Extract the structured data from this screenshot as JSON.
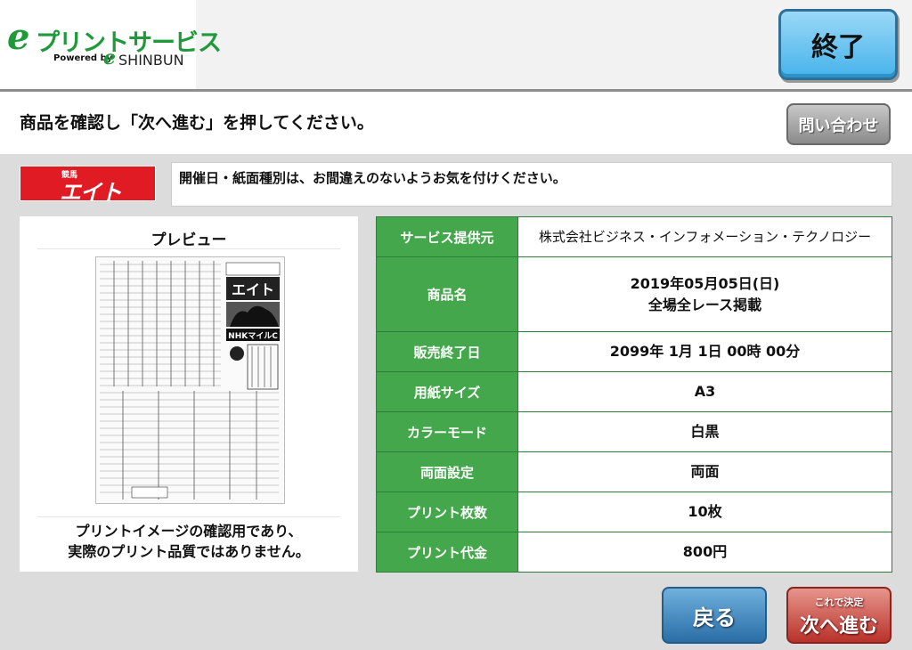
{
  "header": {
    "logo_e": "e",
    "logo_main": "プリントサービス",
    "logo_powered_by": "Powered by",
    "logo_e2": "e",
    "logo_shinbun": "SHINBUN",
    "end_button": "終了"
  },
  "instruction": {
    "text": "商品を確認し「次へ進む」を押してください。",
    "contact_button": "問い合わせ"
  },
  "paper_logo": {
    "small": "競馬",
    "big": "エイト",
    "color": "#e11b23"
  },
  "notice": "開催日・紙面種別は、お間違えのないようお気を付けください。",
  "preview": {
    "title": "プレビュー",
    "thumbnail_headline": "NHKマイルC",
    "thumbnail_masthead": "エイト",
    "caption_line1": "プリントイメージの確認用であり、",
    "caption_line2": "実際のプリント品質ではありません。"
  },
  "details": [
    {
      "label": "サービス提供元",
      "value": "株式会社ビジネス・インフォメーション・テクノロジー"
    },
    {
      "label": "商品名",
      "value": "2019年05月05日(日)",
      "value2": "全場全レース掲載"
    },
    {
      "label": "販売終了日",
      "value": "2099年 1月 1日 00時 00分"
    },
    {
      "label": "用紙サイズ",
      "value": "A3"
    },
    {
      "label": "カラーモード",
      "value": "白黒"
    },
    {
      "label": "両面設定",
      "value": "両面"
    },
    {
      "label": "プリント枚数",
      "value": "10枚"
    },
    {
      "label": "プリント代金",
      "value": "800円"
    }
  ],
  "buttons": {
    "back": "戻る",
    "next_small": "これで決定",
    "next_big": "次へ進む"
  },
  "colors": {
    "brand_green": "#1f9a3a",
    "table_header_green": "#45a74c",
    "end_button_blue": "#46b3ea",
    "back_button_blue": "#2a6ea6",
    "next_button_red": "#b8322a"
  }
}
